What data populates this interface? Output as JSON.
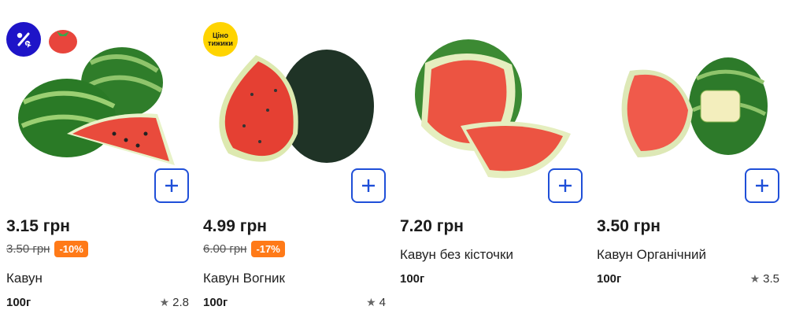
{
  "products": [
    {
      "price": "3.15 грн",
      "old_price": "3.50 грн",
      "discount": "-10%",
      "name": "Кавун",
      "weight": "100г",
      "rating": "2.8"
    },
    {
      "price": "4.99 грн",
      "old_price": "6.00 грн",
      "discount": "-17%",
      "name": "Кавун Вогник",
      "weight": "100г",
      "rating": "4",
      "badge_text_1": "Ціно",
      "badge_text_2": "тижики"
    },
    {
      "price": "7.20 грн",
      "name": "Кавун без кісточки",
      "weight": "100г"
    },
    {
      "price": "3.50 грн",
      "name": "Кавун Органічний",
      "weight": "100г",
      "rating": "3.5"
    }
  ],
  "colors": {
    "accent_blue": "#1f4fd8",
    "discount_orange": "#ff7a18",
    "badge_blue": "#1e14c8",
    "badge_yellow": "#ffd400"
  }
}
